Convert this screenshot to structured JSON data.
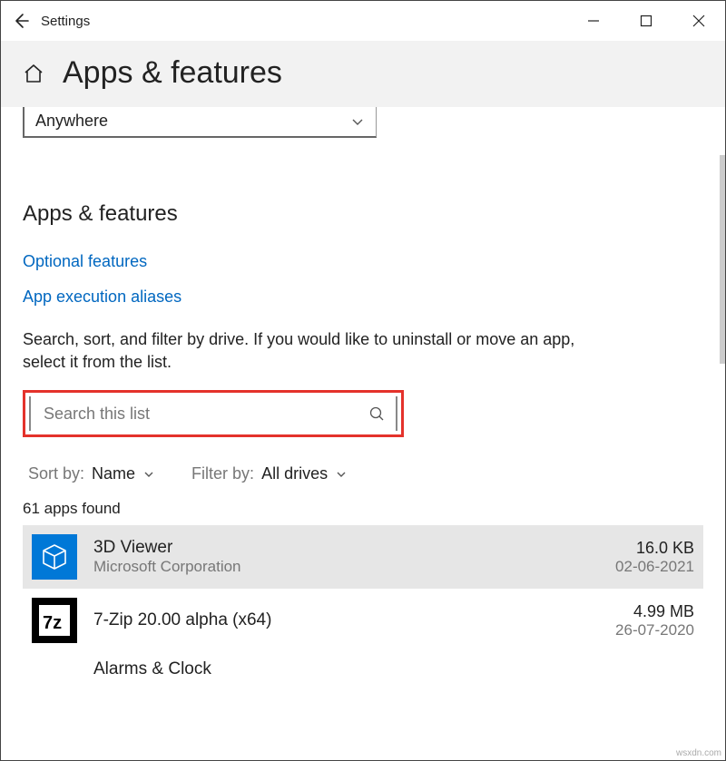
{
  "titlebar": {
    "title": "Settings"
  },
  "header": {
    "title": "Apps & features"
  },
  "install_source": {
    "value": "Anywhere"
  },
  "section_title": "Apps & features",
  "links": {
    "optional_features": "Optional features",
    "app_execution_aliases": "App execution aliases"
  },
  "helper_text": "Search, sort, and filter by drive. If you would like to uninstall or move an app, select it from the list.",
  "search": {
    "placeholder": "Search this list"
  },
  "sort": {
    "label": "Sort by:",
    "value": "Name"
  },
  "filter": {
    "label": "Filter by:",
    "value": "All drives"
  },
  "count_text": "61 apps found",
  "apps": [
    {
      "name": "3D Viewer",
      "publisher": "Microsoft Corporation",
      "size": "16.0 KB",
      "date": "02-06-2021"
    },
    {
      "name": "7-Zip 20.00 alpha (x64)",
      "publisher": "",
      "size": "4.99 MB",
      "date": "26-07-2020"
    },
    {
      "name": "Alarms & Clock",
      "publisher": "",
      "size": "",
      "date": ""
    }
  ],
  "attribution": "wsxdn.com"
}
